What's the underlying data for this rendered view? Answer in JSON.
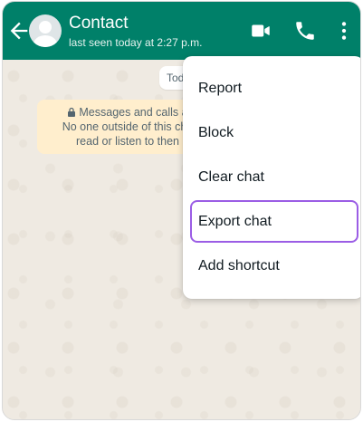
{
  "header": {
    "contact_name": "Contact",
    "last_seen": "last seen today at 2:27 p.m.",
    "bg_color": "#008069",
    "icons": [
      "back-arrow-icon",
      "avatar",
      "video-call-icon",
      "phone-icon",
      "more-vert-icon"
    ]
  },
  "chat": {
    "date_chip": "Today",
    "encryption_lines": [
      "Messages and calls a",
      "No one outside of this cha",
      "read or listen to then"
    ]
  },
  "menu": {
    "items": [
      {
        "label": "Report"
      },
      {
        "label": "Block"
      },
      {
        "label": "Clear chat"
      },
      {
        "label": "Export chat"
      },
      {
        "label": "Add shortcut"
      }
    ],
    "highlighted": "Export chat",
    "highlight_color": "#9b5de5"
  }
}
